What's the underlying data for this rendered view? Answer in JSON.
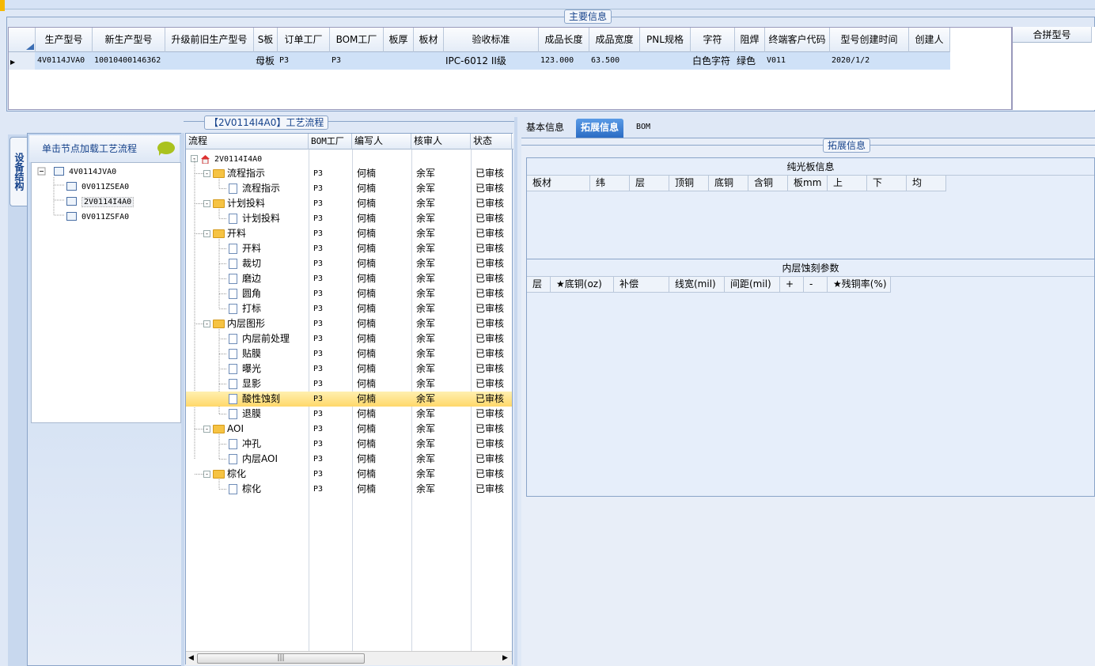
{
  "main_info": {
    "title": "主要信息",
    "columns": [
      "生产型号",
      "新生产型号",
      "升级前旧生产型号",
      "S板",
      "订单工厂",
      "BOM工厂",
      "板厚",
      "板材",
      "验收标准",
      "成品长度",
      "成品宽度",
      "PNL规格",
      "字符",
      "阻焊",
      "终端客户代码",
      "型号创建时间",
      "创建人"
    ],
    "row": [
      "4V0114JVA0",
      "10010400146362",
      "",
      "母板",
      "P3",
      "P3",
      "",
      "",
      "IPC-6012 II级",
      "123.000",
      "63.500",
      "",
      "白色字符",
      "绿色",
      "V011",
      "2020/1/2",
      ""
    ],
    "merge_header": "合拼型号"
  },
  "left_panel": {
    "vtab_label": "设备结构",
    "header": "单击节点加载工艺流程",
    "tree": {
      "root": "4V0114JVA0",
      "children": [
        "0V011ZSEA0",
        "2V0114I4A0",
        "0V011ZSFA0"
      ]
    }
  },
  "process": {
    "title": "【2V0114I4A0】工艺流程",
    "columns": [
      "流程",
      "BOM工厂",
      "编写人",
      "核审人",
      "状态"
    ],
    "root": "2V0114I4A0",
    "rows": [
      {
        "name": "流程指示",
        "level": 1,
        "factory": "P3",
        "writer": "何楠",
        "reviewer": "余军",
        "status": "已审核"
      },
      {
        "name": "流程指示",
        "level": 2,
        "factory": "P3",
        "writer": "何楠",
        "reviewer": "余军",
        "status": "已审核"
      },
      {
        "name": "计划投料",
        "level": 1,
        "factory": "P3",
        "writer": "何楠",
        "reviewer": "余军",
        "status": "已审核"
      },
      {
        "name": "计划投料",
        "level": 2,
        "factory": "P3",
        "writer": "何楠",
        "reviewer": "余军",
        "status": "已审核"
      },
      {
        "name": "开料",
        "level": 1,
        "factory": "P3",
        "writer": "何楠",
        "reviewer": "余军",
        "status": "已审核"
      },
      {
        "name": "开料",
        "level": 2,
        "factory": "P3",
        "writer": "何楠",
        "reviewer": "余军",
        "status": "已审核"
      },
      {
        "name": "裁切",
        "level": 2,
        "factory": "P3",
        "writer": "何楠",
        "reviewer": "余军",
        "status": "已审核"
      },
      {
        "name": "磨边",
        "level": 2,
        "factory": "P3",
        "writer": "何楠",
        "reviewer": "余军",
        "status": "已审核"
      },
      {
        "name": "圆角",
        "level": 2,
        "factory": "P3",
        "writer": "何楠",
        "reviewer": "余军",
        "status": "已审核"
      },
      {
        "name": "打标",
        "level": 2,
        "factory": "P3",
        "writer": "何楠",
        "reviewer": "余军",
        "status": "已审核"
      },
      {
        "name": "内层图形",
        "level": 1,
        "factory": "P3",
        "writer": "何楠",
        "reviewer": "余军",
        "status": "已审核"
      },
      {
        "name": "内层前处理",
        "level": 2,
        "factory": "P3",
        "writer": "何楠",
        "reviewer": "余军",
        "status": "已审核"
      },
      {
        "name": "贴膜",
        "level": 2,
        "factory": "P3",
        "writer": "何楠",
        "reviewer": "余军",
        "status": "已审核"
      },
      {
        "name": "曝光",
        "level": 2,
        "factory": "P3",
        "writer": "何楠",
        "reviewer": "余军",
        "status": "已审核"
      },
      {
        "name": "显影",
        "level": 2,
        "factory": "P3",
        "writer": "何楠",
        "reviewer": "余军",
        "status": "已审核"
      },
      {
        "name": "酸性蚀刻",
        "level": 2,
        "factory": "P3",
        "writer": "何楠",
        "reviewer": "余军",
        "status": "已审核",
        "selected": true
      },
      {
        "name": "退膜",
        "level": 2,
        "factory": "P3",
        "writer": "何楠",
        "reviewer": "余军",
        "status": "已审核"
      },
      {
        "name": "AOI",
        "level": 1,
        "factory": "P3",
        "writer": "何楠",
        "reviewer": "余军",
        "status": "已审核"
      },
      {
        "name": "冲孔",
        "level": 2,
        "factory": "P3",
        "writer": "何楠",
        "reviewer": "余军",
        "status": "已审核"
      },
      {
        "name": "内层AOI",
        "level": 2,
        "factory": "P3",
        "writer": "何楠",
        "reviewer": "余军",
        "status": "已审核"
      },
      {
        "name": "棕化",
        "level": 1,
        "factory": "P3",
        "writer": "何楠",
        "reviewer": "余军",
        "status": "已审核"
      },
      {
        "name": "棕化",
        "level": 2,
        "factory": "P3",
        "writer": "何楠",
        "reviewer": "余军",
        "status": "已审核"
      }
    ],
    "scroll_thumb": "|||"
  },
  "right_panel": {
    "tabs": [
      "基本信息",
      "拓展信息",
      "BOM"
    ],
    "active_tab": "拓展信息",
    "group_title": "拓展信息",
    "plain_board": {
      "title": "纯光板信息",
      "columns": [
        "板材",
        "纬",
        "层",
        "顶铜",
        "底铜",
        "含铜",
        "板mm",
        "上",
        "下",
        "均"
      ]
    },
    "inner_etch": {
      "title": "内层蚀刻参数",
      "columns": [
        "层",
        "★底铜(oz)",
        "补偿",
        "线宽(mil)",
        "间距(mil)",
        "+",
        "-",
        "★残铜率(%)"
      ]
    }
  }
}
